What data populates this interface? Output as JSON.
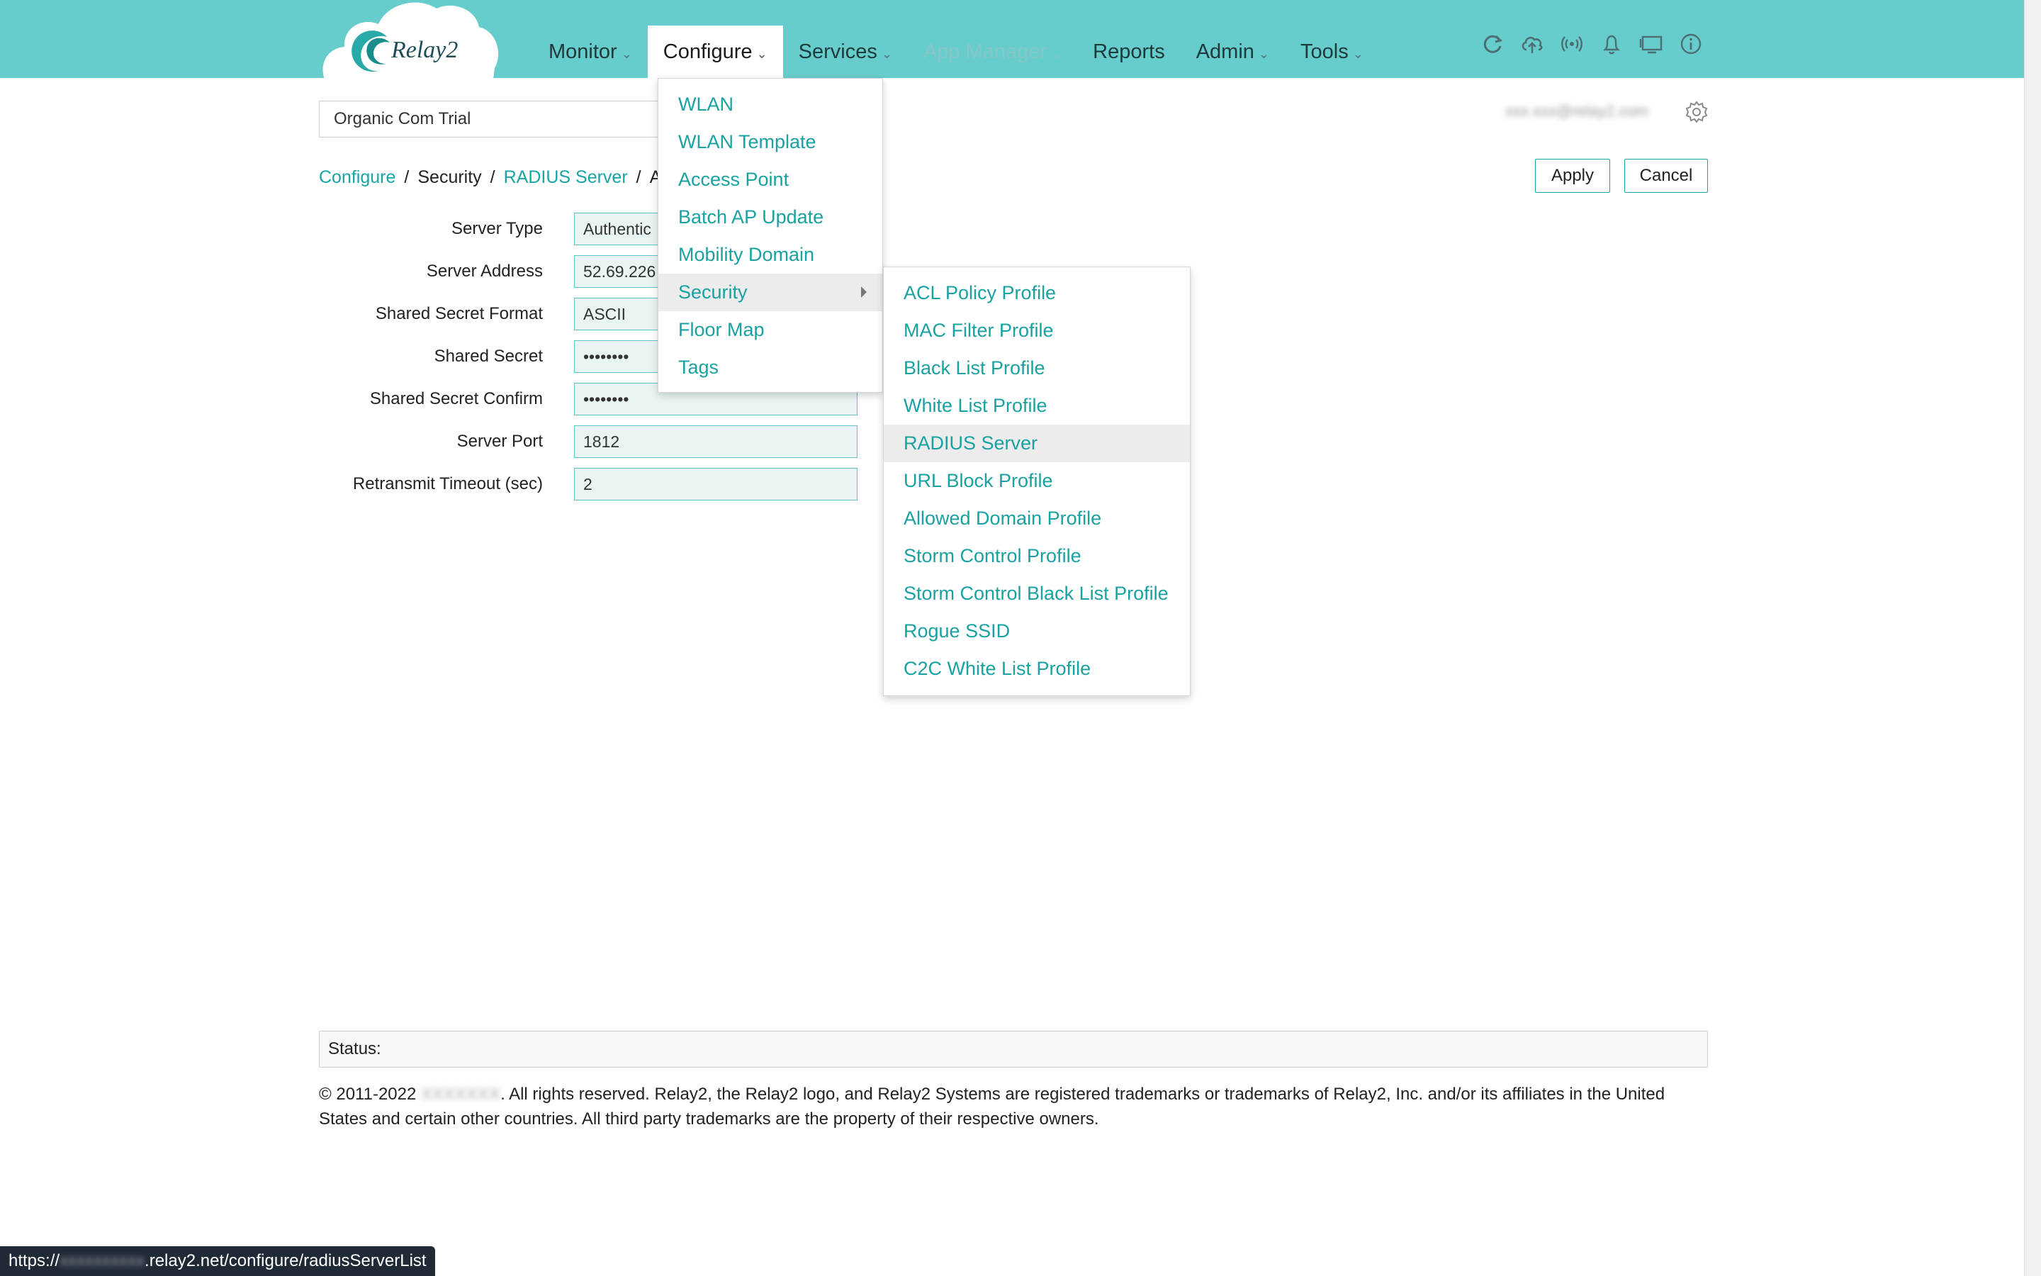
{
  "brand": {
    "logo_text": "Relay2"
  },
  "nav": {
    "items": [
      {
        "label": "Monitor",
        "caret": "⌄"
      },
      {
        "label": "Configure",
        "caret": "⌄"
      },
      {
        "label": "Services",
        "caret": "⌄"
      },
      {
        "label": "App Manager",
        "caret": "⌄"
      },
      {
        "label": "Reports"
      },
      {
        "label": "Admin",
        "caret": "⌄"
      },
      {
        "label": "Tools",
        "caret": "⌄"
      }
    ],
    "active": "Configure",
    "disabled": "App Manager"
  },
  "toolbar_icons": [
    "refresh-icon",
    "cloud-upload-icon",
    "wireless-icon",
    "bell-icon",
    "screen-share-icon",
    "info-icon"
  ],
  "org_selector": {
    "value": "Organic Com Trial"
  },
  "user": {
    "email": "xxx.xxx@relay2.com"
  },
  "breadcrumb": {
    "items": [
      "Configure",
      "Security",
      "RADIUS Server",
      "Ad"
    ],
    "separator": "/"
  },
  "actions": {
    "apply_label": "Apply",
    "cancel_label": "Cancel"
  },
  "form": {
    "server_type": {
      "label": "Server Type",
      "value": "Authentic"
    },
    "server_address": {
      "label": "Server Address",
      "value": "52.69.226"
    },
    "secret_format": {
      "label": "Shared Secret Format",
      "value": "ASCII"
    },
    "shared_secret": {
      "label": "Shared Secret",
      "value": "••••••••"
    },
    "secret_confirm": {
      "label": "Shared Secret Confirm",
      "value": "••••••••"
    },
    "server_port": {
      "label": "Server Port",
      "value": "1812"
    },
    "retransmit_timeout": {
      "label": "Retransmit Timeout (sec)",
      "value": "2"
    }
  },
  "configure_menu": {
    "items": [
      "WLAN",
      "WLAN Template",
      "Access Point",
      "Batch AP Update",
      "Mobility Domain",
      "Security",
      "Floor Map",
      "Tags"
    ],
    "hovered": "Security"
  },
  "security_menu": {
    "items": [
      "ACL Policy Profile",
      "MAC Filter Profile",
      "Black List Profile",
      "White List Profile",
      "RADIUS Server",
      "URL Block Profile",
      "Allowed Domain Profile",
      "Storm Control Profile",
      "Storm Control Black List Profile",
      "Rogue SSID",
      "C2C White List Profile"
    ],
    "hovered": "RADIUS Server"
  },
  "status": {
    "label": "Status:"
  },
  "footer": {
    "prefix": "© 2011-2022 ",
    "company": "XXXXXXX",
    "text": ". All rights reserved. Relay2, the Relay2 logo, and Relay2 Systems are registered trademarks or trademarks of Relay2, Inc. and/or its affiliates in the United States and certain other countries. All third party trademarks are the property of their respective owners."
  },
  "link_preview": {
    "prefix": "https://",
    "host_hidden": "xxxxxxxxxx",
    "suffix": ".relay2.net/configure/radiusServerList"
  },
  "colors": {
    "header": "#66cccc",
    "accent": "#18a5a5",
    "link": "#1aa1a1"
  }
}
